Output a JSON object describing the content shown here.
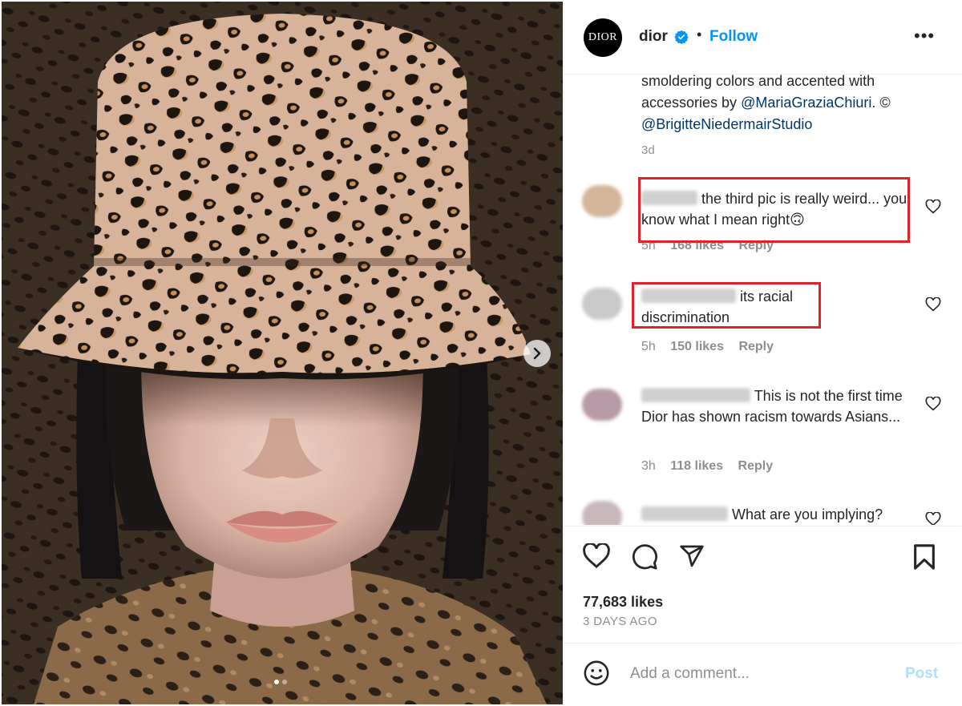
{
  "post": {
    "username": "dior",
    "avatar_text": "DIOR",
    "verified_icon": "verified-badge-icon",
    "separator": "•",
    "follow_label": "Follow",
    "more_label": "•••"
  },
  "caption": {
    "text_lead": "smoldering colors and accented with accessories by ",
    "mention_1": "@MariaGraziaChiuri",
    "text_mid": ". © ",
    "mention_2": "@BrigitteNiedermairStudio",
    "time": "3d"
  },
  "comments": [
    {
      "visible_username_fragment": "",
      "text": "the third pic is really weird... you know what I mean right",
      "emoji": "🙃",
      "time": "5h",
      "likes": "168 likes",
      "reply": "Reply"
    },
    {
      "text": "its racial discrimination",
      "time": "5h",
      "likes": "150 likes",
      "reply": "Reply"
    },
    {
      "text": "This is not the first time Dior has shown racism towards Asians...",
      "time": "3h",
      "likes": "118 likes",
      "reply": "Reply"
    },
    {
      "text": "What are you implying?"
    }
  ],
  "actions": {
    "like_icon": "heart-icon",
    "comment_icon": "comment-bubble-icon",
    "share_icon": "paper-plane-icon",
    "save_icon": "bookmark-icon"
  },
  "stats": {
    "likes": "77,683 likes",
    "date": "3 DAYS AGO"
  },
  "composer": {
    "placeholder": "Add a comment...",
    "post_label": "Post"
  },
  "carousel": {
    "total_slides": 2,
    "active_slide": 1
  },
  "colors": {
    "follow": "#0095f6",
    "verified": "#0095f6",
    "mention": "#00376b",
    "muted": "#8e8e8e",
    "highlight_box": "#e0232a",
    "post_disabled": "#b2dffc"
  }
}
